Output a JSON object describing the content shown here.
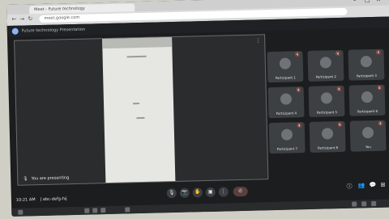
{
  "browser": {
    "tab_title": "Meet - Future technology",
    "url": "meet.google.com",
    "window_controls": [
      "–",
      "□",
      "✕"
    ]
  },
  "meet": {
    "header_title": "Future technology Presentation",
    "presenter_label": "You are presenting",
    "time": "10:21 AM",
    "meeting_code": "|  abc-defg-hij",
    "participants": [
      {
        "name": "Participant 1"
      },
      {
        "name": "Participant 2"
      },
      {
        "name": "Participant 3"
      },
      {
        "name": "Participant 4"
      },
      {
        "name": "Participant 5"
      },
      {
        "name": "Participant 6"
      },
      {
        "name": "Participant 7"
      },
      {
        "name": "Participant 8"
      },
      {
        "name": "You"
      }
    ],
    "controls": [
      "🎙",
      "📷",
      "✋",
      "▣",
      "⋮",
      "✆"
    ]
  },
  "colors": {
    "background": "#1c1d1f",
    "tile": "#3c4043",
    "accent": "#8ab4f8"
  }
}
